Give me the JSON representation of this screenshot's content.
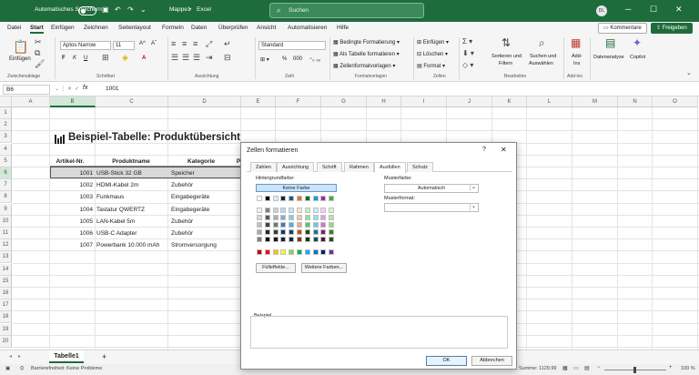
{
  "titlebar": {
    "autosave_label": "Automatisches Speichern",
    "file_name": "Mappe1",
    "app_name": "Excel",
    "search_placeholder": "Suchen",
    "avatar_initials": "DL"
  },
  "menu": {
    "items": [
      "Datei",
      "Start",
      "Einfügen",
      "Zeichnen",
      "Seitenlayout",
      "Formeln",
      "Daten",
      "Überprüfen",
      "Ansicht",
      "Automatisieren",
      "Hilfe"
    ],
    "active": "Start",
    "comments_label": "Kommentare",
    "share_label": "Freigeben"
  },
  "ribbon": {
    "paste_label": "Einfügen",
    "clipboard_group": "Zwischenablage",
    "font_name": "Aptos Narrow",
    "font_size": "11",
    "font_group": "Schriftart",
    "alignment_group": "Ausrichtung",
    "number_format": "Standard",
    "number_group": "Zahl",
    "cond_format": "Bedingte Formatierung",
    "as_table": "Als Tabelle formatieren",
    "cell_styles": "Zellenformatvorlagen",
    "styles_group": "Formatvorlagen",
    "insert": "Einfügen",
    "delete": "Löschen",
    "format": "Format",
    "cells_group": "Zellen",
    "sort_filter_1": "Sortieren und",
    "sort_filter_2": "Filtern",
    "find_select_1": "Suchen und",
    "find_select_2": "Auswählen",
    "editing_group": "Bearbeiten",
    "addins_1": "Add-",
    "addins_2": "Ins",
    "addins_group": "Add-ins",
    "data_analysis": "Datenanalyse",
    "copilot": "Copilot"
  },
  "formulabar": {
    "namebox": "B6",
    "fx": "fx",
    "content": "1001"
  },
  "grid": {
    "columns": [
      "A",
      "B",
      "C",
      "D",
      "E",
      "F",
      "G",
      "H",
      "I",
      "J",
      "K",
      "L",
      "M",
      "N",
      "O"
    ],
    "rows": [
      "1",
      "2",
      "3",
      "4",
      "5",
      "6",
      "7",
      "8",
      "9",
      "10",
      "11",
      "12",
      "13",
      "14",
      "15",
      "16",
      "17",
      "18",
      "19",
      "20"
    ],
    "title": "Beispiel-Tabelle: Produktübersicht",
    "headers": [
      "Artikel-Nr.",
      "Produktname",
      "Kategorie",
      "P"
    ],
    "data": [
      [
        "1001",
        "USB-Stick 32 GB",
        "Speicher"
      ],
      [
        "1002",
        "HDMI-Kabel 2m",
        "Zubehör"
      ],
      [
        "1003",
        "Funkmaus",
        "Eingabegeräte"
      ],
      [
        "1004",
        "Tastatur QWERTZ",
        "Eingabegeräte"
      ],
      [
        "1005",
        "LAN-Kabel 5m",
        "Zubehör"
      ],
      [
        "1006",
        "USB-C Adapter",
        "Zubehör"
      ],
      [
        "1007",
        "Powerbank 10.000 mAh",
        "Stromversorgung"
      ]
    ]
  },
  "sheets": {
    "active": "Tabelle1",
    "add": "+"
  },
  "statusbar": {
    "accessibility": "Barrierefreiheit: Keine Probleme",
    "sum": "Summe: 1129,99",
    "zoom": "100 %"
  },
  "dialog": {
    "title": "Zellen formatieren",
    "help": "?",
    "tabs": [
      "Zahlen",
      "Ausrichtung",
      "Schrift",
      "Rahmen",
      "Ausfüllen",
      "Schutz"
    ],
    "active_tab": "Ausfüllen",
    "bg_color_label": "Hintergrundfarbe:",
    "no_color": "Keine Farbe",
    "fill_effects": "Fülleffekte...",
    "more_colors": "Weitere Farben...",
    "pattern_color_label": "Musterfarbe:",
    "pattern_color_value": "Automatisch",
    "pattern_style_label": "Musterformat:",
    "sample_label": "Beispiel",
    "ok": "OK",
    "cancel": "Abbrechen",
    "theme_colors": [
      [
        "#ffffff",
        "#000000",
        "#e8e8e8",
        "#0e2841",
        "#156082",
        "#e97132",
        "#196b24",
        "#0f9ed5",
        "#a02b93",
        "#4ea72e"
      ],
      [
        "#f2f2f2",
        "#7f7f7f",
        "#d0d0d0",
        "#c0d7ef",
        "#c1e4f5",
        "#fbe2d5",
        "#c1f0c8",
        "#caeefb",
        "#f2cfee",
        "#daf2d0"
      ],
      [
        "#d9d9d9",
        "#595959",
        "#aeaeae",
        "#83acdc",
        "#83cbeb",
        "#f7c7ac",
        "#8ee09c",
        "#95dcf7",
        "#e59edd",
        "#b5e6a2"
      ],
      [
        "#bfbfbf",
        "#404040",
        "#757575",
        "#4577bd",
        "#45b0e1",
        "#f1a983",
        "#48cf61",
        "#61cbf3",
        "#d86dcd",
        "#8ed973"
      ],
      [
        "#a6a6a6",
        "#262626",
        "#3a3a3a",
        "#17375e",
        "#0f4761",
        "#c04f15",
        "#124f1a",
        "#0b76a0",
        "#78206e",
        "#3b7d23"
      ],
      [
        "#808080",
        "#0d0d0d",
        "#171717",
        "#0f253f",
        "#0a2f40",
        "#80350e",
        "#0d3512",
        "#074f69",
        "#501549",
        "#275317"
      ]
    ],
    "standard_colors": [
      "#c00000",
      "#ff0000",
      "#ffc000",
      "#ffff00",
      "#92d050",
      "#00b050",
      "#00b0f0",
      "#0070c0",
      "#002060",
      "#7030a0"
    ]
  }
}
